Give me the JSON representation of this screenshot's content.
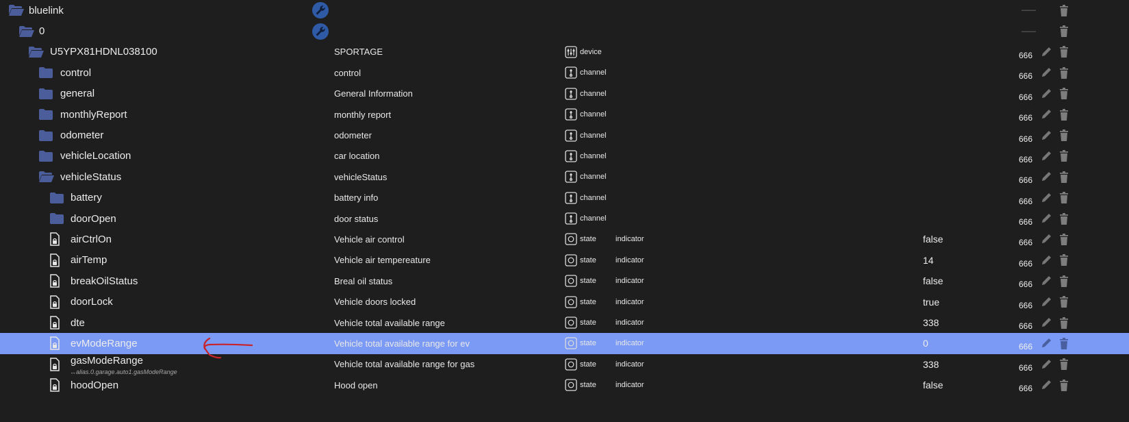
{
  "colors": {
    "background": "#1e1e1e",
    "selected_row": "#7b9af5",
    "folder": "#4c5d9c",
    "annotation_arrow": "#c8232b"
  },
  "rows": [
    {
      "name": "bluelink",
      "kind": "folder-open",
      "indent": 0
    },
    {
      "name": "0",
      "kind": "folder-open",
      "indent": 1
    },
    {
      "name": "U5YPX81HDNL038100",
      "desc": "SPORTAGE",
      "type": "device",
      "acl": "666",
      "kind": "folder-open",
      "indent": 2
    },
    {
      "name": "control",
      "desc": "control",
      "type": "channel",
      "acl": "666",
      "kind": "folder",
      "indent": 3
    },
    {
      "name": "general",
      "desc": "General Information",
      "type": "channel",
      "acl": "666",
      "kind": "folder",
      "indent": 3
    },
    {
      "name": "monthlyReport",
      "desc": "monthly report",
      "type": "channel",
      "acl": "666",
      "kind": "folder",
      "indent": 3
    },
    {
      "name": "odometer",
      "desc": "odometer",
      "type": "channel",
      "acl": "666",
      "kind": "folder",
      "indent": 3
    },
    {
      "name": "vehicleLocation",
      "desc": "car location",
      "type": "channel",
      "acl": "666",
      "kind": "folder",
      "indent": 3
    },
    {
      "name": "vehicleStatus",
      "desc": "vehicleStatus",
      "type": "channel",
      "acl": "666",
      "kind": "folder-open",
      "indent": 3
    },
    {
      "name": "battery",
      "desc": "battery info",
      "type": "channel",
      "acl": "666",
      "kind": "folder",
      "indent": 4
    },
    {
      "name": "doorOpen",
      "desc": "door status",
      "type": "channel",
      "acl": "666",
      "kind": "folder",
      "indent": 4
    },
    {
      "name": "airCtrlOn",
      "desc": "Vehicle air control",
      "type": "state",
      "role": "indicator",
      "value": "false",
      "acl": "666",
      "kind": "file",
      "indent": 4
    },
    {
      "name": "airTemp",
      "desc": "Vehicle air tempereature",
      "type": "state",
      "role": "indicator",
      "value": "14",
      "acl": "666",
      "kind": "file",
      "indent": 4
    },
    {
      "name": "breakOilStatus",
      "desc": "Breal oil status",
      "type": "state",
      "role": "indicator",
      "value": "false",
      "acl": "666",
      "kind": "file",
      "indent": 4
    },
    {
      "name": "doorLock",
      "desc": "Vehicle doors locked",
      "type": "state",
      "role": "indicator",
      "value": "true",
      "acl": "666",
      "kind": "file",
      "indent": 4
    },
    {
      "name": "dte",
      "desc": "Vehicle total available range",
      "type": "state",
      "role": "indicator",
      "value": "338",
      "acl": "666",
      "kind": "file",
      "indent": 4
    },
    {
      "name": "evModeRange",
      "desc": "Vehicle total available range for ev",
      "type": "state",
      "role": "indicator",
      "value": "0",
      "acl": "666",
      "kind": "file",
      "indent": 4,
      "selected": true
    },
    {
      "name": "gasModeRange",
      "alias": "↔alias.0.garage.auto1.gasModeRange",
      "desc": "Vehicle total available range for gas",
      "type": "state",
      "role": "indicator",
      "value": "338",
      "acl": "666",
      "kind": "file",
      "indent": 4
    },
    {
      "name": "hoodOpen",
      "desc": "Hood open",
      "type": "state",
      "role": "indicator",
      "value": "false",
      "acl": "666",
      "kind": "file",
      "indent": 4
    }
  ]
}
